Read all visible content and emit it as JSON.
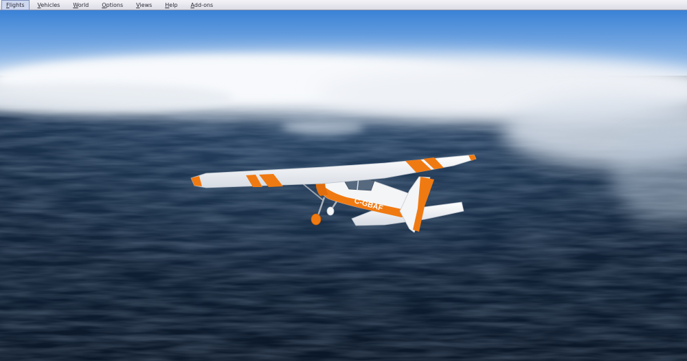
{
  "menubar": {
    "items": [
      {
        "label": "Flights",
        "mnemonic": "F",
        "rest": "lights",
        "active": true
      },
      {
        "label": "Vehicles",
        "mnemonic": "V",
        "rest": "ehicles",
        "active": false
      },
      {
        "label": "World",
        "mnemonic": "W",
        "rest": "orld",
        "active": false
      },
      {
        "label": "Options",
        "mnemonic": "O",
        "rest": "ptions",
        "active": false
      },
      {
        "label": "Views",
        "mnemonic": "V",
        "rest": "iews",
        "active": false
      },
      {
        "label": "Help",
        "mnemonic": "H",
        "rest": "elp",
        "active": false
      },
      {
        "label": "Add-ons",
        "mnemonic": "A",
        "rest": "dd-ons",
        "active": false
      }
    ]
  },
  "aircraft": {
    "registration": "C-GBAF",
    "colors": {
      "body": "#f4f5f7",
      "stripe": "#f07a12",
      "window": "#5b6f86"
    }
  },
  "scene": {
    "colors": {
      "sky_top": "#3f86d9",
      "sky_horizon": "#a9c9ec",
      "cloud": "#f2f4f8",
      "ocean_deep": "#0b1a2e",
      "ocean_mid": "#1e3b5e"
    }
  }
}
